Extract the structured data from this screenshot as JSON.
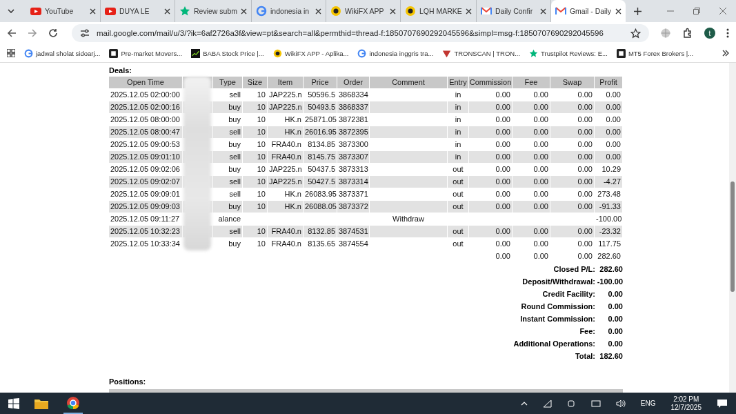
{
  "browser": {
    "tabs": [
      {
        "title": "YouTube",
        "kind": "youtube",
        "selected": false
      },
      {
        "title": "DUYA LE",
        "kind": "youtube",
        "selected": false
      },
      {
        "title": "Review subm",
        "kind": "star",
        "selected": false
      },
      {
        "title": "indonesia in",
        "kind": "google",
        "selected": false
      },
      {
        "title": "WikiFX APP",
        "kind": "wikifx",
        "selected": false
      },
      {
        "title": "LQH MARKE",
        "kind": "wikifx",
        "selected": false
      },
      {
        "title": "Daily Confir",
        "kind": "gmail",
        "selected": false
      },
      {
        "title": "Gmail - Daily",
        "kind": "gmail",
        "selected": true
      }
    ],
    "url": "mail.google.com/mail/u/3/?ik=6af2726a3f&view=pt&search=all&permthid=thread-f:1850707690292045596&simpl=msg-f:1850707690292045596",
    "profile_initial": "t",
    "bookmarks": [
      {
        "title": "jadwal sholat sidoarj...",
        "kind": "google"
      },
      {
        "title": "Pre-market Movers...",
        "kind": "dark"
      },
      {
        "title": "BABA Stock Price |...",
        "kind": "chart"
      },
      {
        "title": "WikiFX APP - Aplika...",
        "kind": "wikifx"
      },
      {
        "title": "indonesia inggris tra...",
        "kind": "google"
      },
      {
        "title": "TRONSCAN | TRON...",
        "kind": "tron"
      },
      {
        "title": "Trustpilot Reviews: E...",
        "kind": "star"
      },
      {
        "title": "MT5 Forex Brokers |...",
        "kind": "dark"
      }
    ]
  },
  "deals": {
    "title": "Deals:",
    "columns": [
      "Open Time",
      "",
      "Type",
      "Size",
      "Item",
      "Price",
      "Order",
      "Comment",
      "Entry",
      "Commission",
      "Fee",
      "Swap",
      "Profit"
    ],
    "rows": [
      [
        "2025.12.05 02:00:00",
        "",
        "sell",
        "10",
        "JAP225.n",
        "50596.5",
        "3868334",
        "",
        "in",
        "0.00",
        "0.00",
        "0.00",
        "0.00"
      ],
      [
        "2025.12.05 02:00:16",
        "",
        "buy",
        "10",
        "JAP225.n",
        "50493.5",
        "3868337",
        "",
        "in",
        "0.00",
        "0.00",
        "0.00",
        "0.00"
      ],
      [
        "2025.12.05 08:00:00",
        "",
        "buy",
        "10",
        "HK.n",
        "25871.05",
        "3872381",
        "",
        "in",
        "0.00",
        "0.00",
        "0.00",
        "0.00"
      ],
      [
        "2025.12.05 08:00:47",
        "",
        "sell",
        "10",
        "HK.n",
        "26016.95",
        "3872395",
        "",
        "in",
        "0.00",
        "0.00",
        "0.00",
        "0.00"
      ],
      [
        "2025.12.05 09:00:53",
        "",
        "buy",
        "10",
        "FRA40.n",
        "8134.85",
        "3873300",
        "",
        "in",
        "0.00",
        "0.00",
        "0.00",
        "0.00"
      ],
      [
        "2025.12.05 09:01:10",
        "",
        "sell",
        "10",
        "FRA40.n",
        "8145.75",
        "3873307",
        "",
        "in",
        "0.00",
        "0.00",
        "0.00",
        "0.00"
      ],
      [
        "2025.12.05 09:02:06",
        "",
        "buy",
        "10",
        "JAP225.n",
        "50437.5",
        "3873313",
        "",
        "out",
        "0.00",
        "0.00",
        "0.00",
        "10.29"
      ],
      [
        "2025.12.05 09:02:07",
        "",
        "sell",
        "10",
        "JAP225.n",
        "50427.5",
        "3873314",
        "",
        "out",
        "0.00",
        "0.00",
        "0.00",
        "-4.27"
      ],
      [
        "2025.12.05 09:09:01",
        "",
        "sell",
        "10",
        "HK.n",
        "26083.95",
        "3873371",
        "",
        "out",
        "0.00",
        "0.00",
        "0.00",
        "273.48"
      ],
      [
        "2025.12.05 09:09:03",
        "",
        "buy",
        "10",
        "HK.n",
        "26088.05",
        "3873372",
        "",
        "out",
        "0.00",
        "0.00",
        "0.00",
        "-91.33"
      ],
      [
        "2025.12.05 09:11:27",
        "",
        "alance",
        "",
        "",
        "",
        "",
        "Withdraw",
        "",
        "",
        "",
        "",
        "-100.00"
      ],
      [
        "2025.12.05 10:32:23",
        "",
        "sell",
        "10",
        "FRA40.n",
        "8132.85",
        "3874531",
        "",
        "out",
        "0.00",
        "0.00",
        "0.00",
        "-23.32"
      ],
      [
        "2025.12.05 10:33:34",
        "",
        "buy",
        "10",
        "FRA40.n",
        "8135.65",
        "3874554",
        "",
        "out",
        "0.00",
        "0.00",
        "0.00",
        "117.75"
      ]
    ],
    "totals": [
      "0.00",
      "0.00",
      "0.00",
      "282.60"
    ],
    "summary": [
      {
        "label": "Closed P/L:",
        "value": "282.60"
      },
      {
        "label": "Deposit/Withdrawal:",
        "value": "-100.00"
      },
      {
        "label": "Credit Facility:",
        "value": "0.00"
      },
      {
        "label": "Round Commission:",
        "value": "0.00"
      },
      {
        "label": "Instant Commission:",
        "value": "0.00"
      },
      {
        "label": "Fee:",
        "value": "0.00"
      },
      {
        "label": "Additional Operations:",
        "value": "0.00"
      },
      {
        "label": "Total:",
        "value": "182.60"
      }
    ]
  },
  "positions": {
    "title": "Positions:"
  },
  "taskbar": {
    "language": "ENG",
    "time": "2:02 PM",
    "date": "12/7/2025"
  }
}
